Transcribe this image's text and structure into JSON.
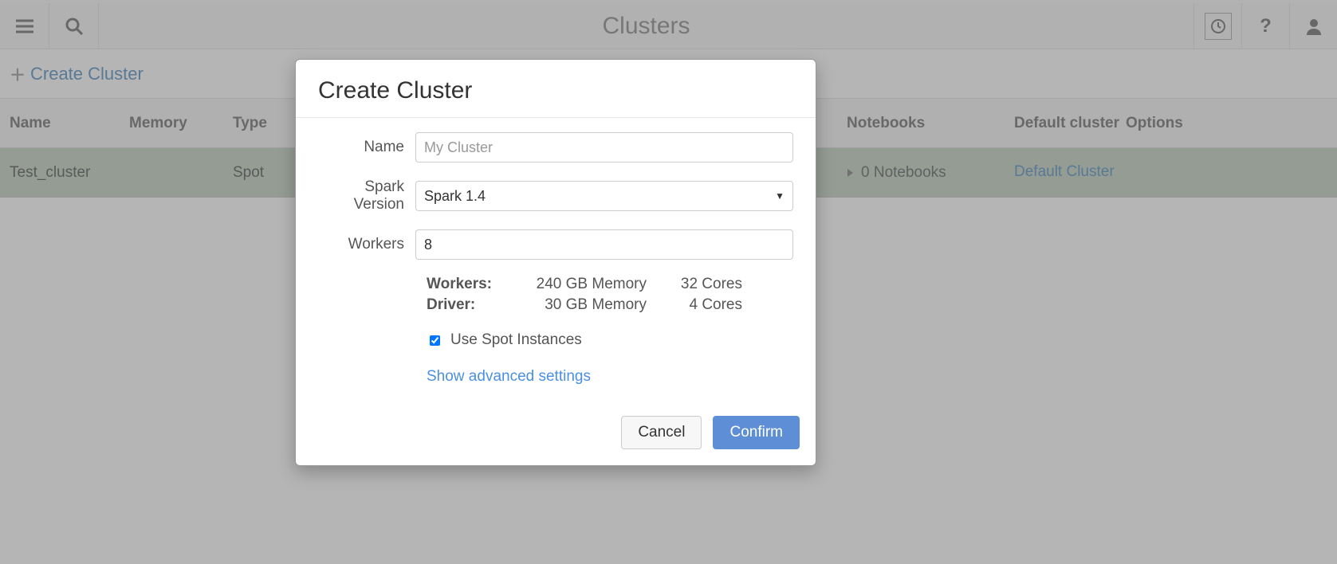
{
  "topbar": {
    "title": "Clusters"
  },
  "subheader": {
    "create_label": "Create Cluster"
  },
  "table": {
    "headers": {
      "name": "Name",
      "memory": "Memory",
      "type": "Type",
      "notebooks": "Notebooks",
      "default": "Default cluster",
      "options": "Options"
    },
    "rows": [
      {
        "name": "Test_cluster",
        "memory": "",
        "type": "Spot",
        "notebooks": "0 Notebooks",
        "default": "Default Cluster"
      }
    ]
  },
  "modal": {
    "title": "Create Cluster",
    "labels": {
      "name": "Name",
      "spark": "Spark Version",
      "workers": "Workers",
      "stat_workers": "Workers:",
      "stat_driver": "Driver:",
      "spot": "Use Spot Instances",
      "advanced": "Show advanced settings",
      "cancel": "Cancel",
      "confirm": "Confirm"
    },
    "values": {
      "name_placeholder": "My Cluster",
      "name_value": "",
      "spark": "Spark 1.4",
      "workers": "8",
      "workers_memory": "240 GB Memory",
      "workers_cores": "32 Cores",
      "driver_memory": "30 GB Memory",
      "driver_cores": "4 Cores",
      "spot_checked": true
    }
  }
}
